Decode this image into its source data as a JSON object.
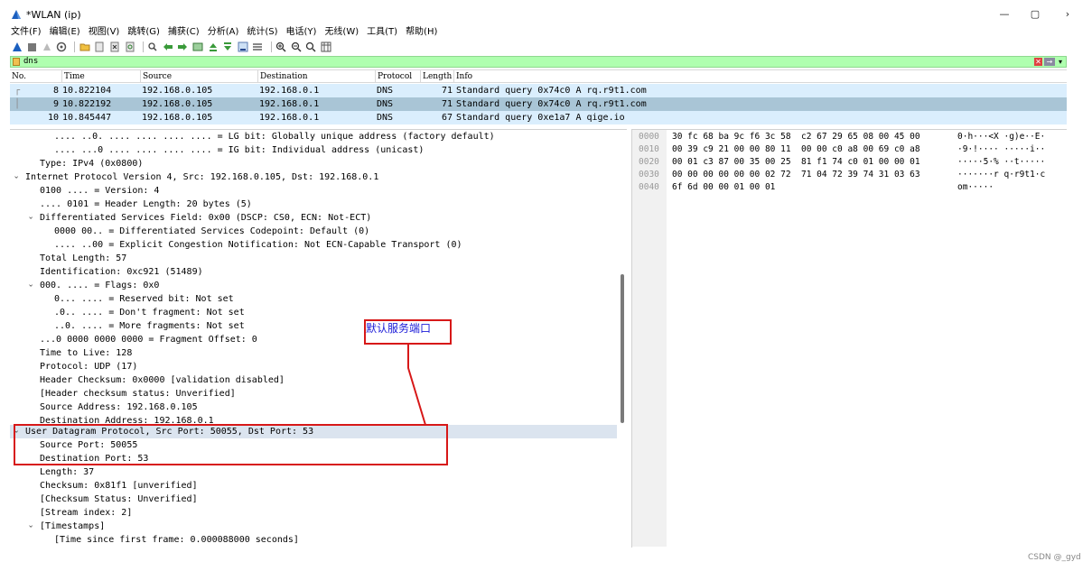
{
  "window": {
    "title": "*WLAN (ip)",
    "minimize_glyph": "—",
    "maximize_glyph": "▢",
    "close_glyph": "›"
  },
  "menu": [
    "文件(F)",
    "编辑(E)",
    "视图(V)",
    "跳转(G)",
    "捕获(C)",
    "分析(A)",
    "统计(S)",
    "电话(Y)",
    "无线(W)",
    "工具(T)",
    "帮助(H)"
  ],
  "toolbar": {
    "icons": [
      "shark-fin-icon",
      "stop-icon",
      "restart-icon",
      "options-gear-icon",
      "open-folder-icon",
      "file-icon",
      "close-file-icon",
      "reload-icon",
      "find-icon",
      "go-back-icon",
      "go-forward-icon",
      "go-to-packet-icon",
      "go-first-icon",
      "go-last-icon",
      "autoscroll-icon",
      "colorize-icon",
      "zoom-in-icon",
      "zoom-out-icon",
      "zoom-normal-icon",
      "resize-columns-icon"
    ]
  },
  "filter": {
    "value": "dns",
    "clear_glyph": "✕",
    "apply_glyph": "→",
    "dropdown_glyph": "▾"
  },
  "packet_list": {
    "columns": [
      "No.",
      "Time",
      "Source",
      "Destination",
      "Protocol",
      "Length",
      "Info"
    ],
    "rows": [
      {
        "no": "8",
        "time": "10.822104",
        "source": "192.168.0.105",
        "destination": "192.168.0.1",
        "protocol": "DNS",
        "length": "71",
        "info": "Standard query 0x74c0 A rq.r9t1.com"
      },
      {
        "no": "9",
        "time": "10.822192",
        "source": "192.168.0.105",
        "destination": "192.168.0.1",
        "protocol": "DNS",
        "length": "71",
        "info": "Standard query 0x74c0 A rq.r9t1.com"
      },
      {
        "no": "10",
        "time": "10.845447",
        "source": "192.168.0.105",
        "destination": "192.168.0.1",
        "protocol": "DNS",
        "length": "67",
        "info": "Standard query 0xe1a7 A qige.io"
      }
    ],
    "related_mark": "┌"
  },
  "details": [
    ".... ..0. .... .... .... .... = LG bit: Globally unique address (factory default)",
    ".... ...0 .... .... .... .... = IG bit: Individual address (unicast)",
    "Type: IPv4 (0x0800)",
    "Internet Protocol Version 4, Src: 192.168.0.105, Dst: 192.168.0.1",
    "0100 .... = Version: 4",
    ".... 0101 = Header Length: 20 bytes (5)",
    "Differentiated Services Field: 0x00 (DSCP: CS0, ECN: Not-ECT)",
    "0000 00.. = Differentiated Services Codepoint: Default (0)",
    ".... ..00 = Explicit Congestion Notification: Not ECN-Capable Transport (0)",
    "Total Length: 57",
    "Identification: 0xc921 (51489)",
    "000. .... = Flags: 0x0",
    "0... .... = Reserved bit: Not set",
    ".0.. .... = Don't fragment: Not set",
    "..0. .... = More fragments: Not set",
    "...0 0000 0000 0000 = Fragment Offset: 0",
    "Time to Live: 128",
    "Protocol: UDP (17)",
    "Header Checksum: 0x0000 [validation disabled]",
    "[Header checksum status: Unverified]",
    "Source Address: 192.168.0.105",
    "Destination Address: 192.168.0.1",
    "User Datagram Protocol, Src Port: 50055, Dst Port: 53",
    "Source Port: 50055",
    "Destination Port: 53",
    "Length: 37",
    "Checksum: 0x81f1 [unverified]",
    "[Checksum Status: Unverified]",
    "[Stream index: 2]",
    "[Timestamps]",
    "[Time since first frame: 0.000088000 seconds]"
  ],
  "tree_arrow": "›",
  "hex": [
    {
      "offset": "0000",
      "bytes": "30 fc 68 ba 9c f6 3c 58  c2 67 29 65 08 00 45 00",
      "ascii": "0·h···<X ·g)e··E·"
    },
    {
      "offset": "0010",
      "bytes": "00 39 c9 21 00 00 80 11  00 00 c0 a8 00 69 c0 a8",
      "ascii": "·9·!···· ·····i··"
    },
    {
      "offset": "0020",
      "bytes": "00 01 c3 87 00 35 00 25  81 f1 74 c0 01 00 00 01",
      "ascii": "·····5·% ··t·····"
    },
    {
      "offset": "0030",
      "bytes": "00 00 00 00 00 00 02 72  71 04 72 39 74 31 03 63",
      "ascii": "·······r q·r9t1·c"
    },
    {
      "offset": "0040",
      "bytes": "6f 6d 00 00 01 00 01",
      "ascii": "om·····"
    }
  ],
  "annotation": {
    "label": "默认服务端口",
    "color": "#d71818",
    "text_color": "#1a1ad8"
  },
  "watermark": "CSDN @_gyd",
  "colors": {
    "filter_bg": "#afffaf",
    "row_bg": "#daeefd",
    "row_selected_bg": "#a9c5d6",
    "detail_selected_bg": "#dbe4ef"
  }
}
